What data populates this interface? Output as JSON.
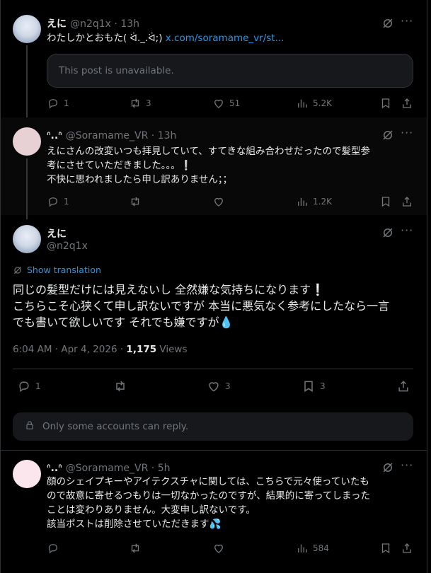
{
  "post1": {
    "name": "えに",
    "handle": "@n2q1x",
    "time": "13h",
    "text_prefix": "わたしかとおもた( ᐛ._.ᐛ;) ",
    "link": "x.com/soramame_vr/st...",
    "quote_unavailable": "This post is unavailable.",
    "replies": "1",
    "reposts": "3",
    "likes": "51",
    "views": "5.2K"
  },
  "post2": {
    "name": "ᐢ..ᐢ",
    "handle": "@Soramame_VR",
    "time": "13h",
    "text": "えにさんの改変いつも拝見していて、すてきな組み合わせだったので髪型参\n考にさせていただきました。。。❕\n不快に思われましたら申し訳ありません；；",
    "replies": "1",
    "reposts": "",
    "likes": "",
    "views": "1.2K"
  },
  "main_post": {
    "name": "えに",
    "handle": "@n2q1x",
    "show_translation": "Show translation",
    "text": "同じの髪型だけには見えないし 全然嫌な気持ちになります❕\nこちらこそ心狭くて申し訳ないですが 本当に悪気なく参考にしたなら一言\nでも書いて欲しいです それでも嫌ですが💧",
    "timestamp": "6:04 AM · Apr 4, 2026 · ",
    "views_count": "1,175",
    "views_label": " Views",
    "replies": "1",
    "likes": "3",
    "bookmarks": "3",
    "reply_restriction": "Only some accounts can reply."
  },
  "post3": {
    "name": "ᐢ..ᐢ",
    "handle": "@Soramame_VR",
    "time": "5h",
    "text": "顔のシェイプキーやアイテクスチャに関しては、こちらで元々使っていたも\nので故意に寄せるつもりは一切なかったのですが、結果的に寄ってしまった\nことは変わりありません。大変申し訳ないです。\n該当ポストは削除させていただきます💦",
    "views": "584"
  },
  "separator": " · ",
  "icons": [
    "reply-icon",
    "repost-icon",
    "like-icon",
    "views-icon",
    "bookmark-icon",
    "share-icon",
    "grok-icon",
    "more-icon",
    "translate-icon",
    "lock-icon"
  ],
  "colors": {
    "background": "#000000",
    "text": "#e7e9ea",
    "muted": "#71767b",
    "accent": "#1d9bf0",
    "border": "#2f3336"
  }
}
